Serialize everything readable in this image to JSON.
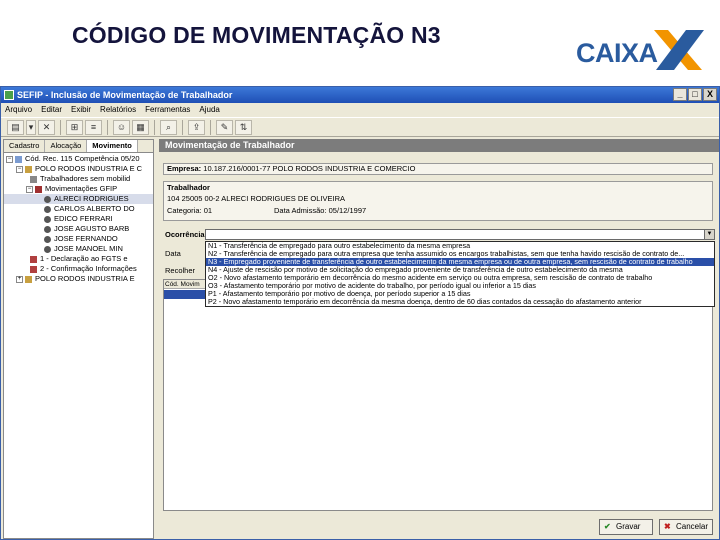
{
  "slide": {
    "title": "CÓDIGO DE MOVIMENTAÇÃO N3",
    "logo_text": "CAIXA",
    "logo_colors": {
      "text": "#2a5b9e",
      "x_orange": "#f29400",
      "x_blue": "#2a5b9e"
    }
  },
  "window": {
    "title": "SEFIP - Inclusão de Movimentação de Trabalhador",
    "buttons": [
      "_",
      "□",
      "X"
    ]
  },
  "menu": [
    "Arquivo",
    "Editar",
    "Exibir",
    "Relatórios",
    "Ferramentas",
    "Ajuda"
  ],
  "toolbar": {
    "icons": [
      "new-icon",
      "tree-view-icon",
      "list-icon",
      "find-icon",
      "export-icon",
      "tools-icon"
    ]
  },
  "left_panel": {
    "tabs": [
      "Cadastro",
      "Alocação",
      "Movimento"
    ],
    "tree": [
      "Cód. Rec. 115 Competência 05/20",
      "POLO RODOS INDUSTRIA E C",
      "Trabalhadores sem mobilid",
      "Movimentações GFIP",
      "ALRECI RODRIGUES",
      "CARLOS ALBERTO DO",
      "EDICO FERRARI",
      "JOSE AGUSTO BARB",
      "JOSE FERNANDO",
      "JOSE MANOEL MIN",
      "1 - Declaração ao FGTS e",
      "2 - Confirmação Informações",
      "POLO RODOS INDUSTRIA E"
    ]
  },
  "right_panel": {
    "header": "Movimentação de Trabalhador",
    "empresa_label": "Empresa:",
    "empresa_value": "10.187.216/0001-77 POLO RODOS INDUSTRIA E COMERCIO",
    "trabalhador_label": "Trabalhador",
    "trabalhador_value": "104 25005 00-2 ALRECI RODRIGUES DE OLIVEIRA",
    "categoria_label": "Categoria:",
    "categoria_value": "01",
    "admissao_label": "Data Admissão:",
    "admissao_value": "05/12/1997",
    "ocorrencia_label": "Ocorrência:",
    "data_label": "Data",
    "recolhimento_label": "Recolher",
    "grid_header": "Cód. Movim",
    "dropdown": [
      "N1 - Transferência de empregado para outro estabelecimento da mesma empresa",
      "N2 - Transferência de empregado para outra empresa que tenha assumido os encargos trabalhistas, sem que tenha havido rescisão de contrato de...",
      "N3 - Empregado proveniente de transferência de outro estabelecimento da mesma empresa ou de outra empresa, sem rescisão de contrato de trabalho",
      "N4 - Ajuste de rescisão por motivo de solicitação do empregado proveniente de transferência de outro estabelecimento da mesma",
      "O2 - Novo afastamento temporário em decorrência do mesmo acidente em serviço ou outra empresa, sem rescisão de contrato de trabalho",
      "O3 - Afastamento temporário por motivo de acidente do trabalho, por período igual ou inferior a 15 dias",
      "P1 - Afastamento temporário por motivo de doença, por período superior a 15 dias",
      "P2 - Novo afastamento temporário em decorrência da mesma doença, dentro de 60 dias contados da cessação do afastamento anterior"
    ],
    "selected_index": 2,
    "save_label": "Gravar",
    "cancel_label": "Cancelar"
  }
}
